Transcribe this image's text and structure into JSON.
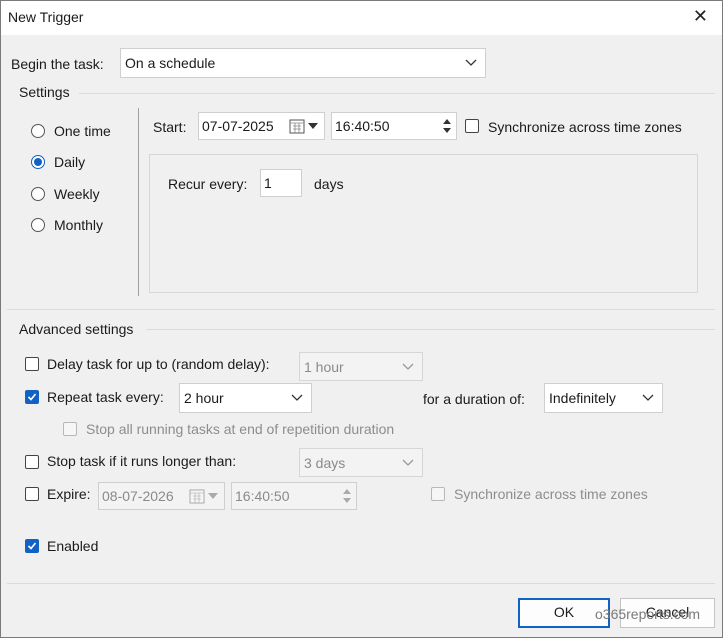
{
  "window": {
    "title": "New Trigger"
  },
  "begin": {
    "label": "Begin the task:",
    "value": "On a schedule"
  },
  "settings": {
    "legend": "Settings",
    "options": [
      "One time",
      "Daily",
      "Weekly",
      "Monthly"
    ],
    "selected": "Daily",
    "start_label": "Start:",
    "start_date": "07-07-2025",
    "start_time": "16:40:50",
    "sync_label": "Synchronize across time zones",
    "sync_checked": false,
    "recur_label": "Recur every:",
    "recur_value": "1",
    "recur_unit": "days"
  },
  "advanced": {
    "legend": "Advanced settings",
    "delay_label": "Delay task for up to (random delay):",
    "delay_checked": false,
    "delay_value": "1 hour",
    "repeat_label": "Repeat task every:",
    "repeat_checked": true,
    "repeat_value": "2 hour",
    "duration_label": "for a duration of:",
    "duration_value": "Indefinitely",
    "stop_all_label": "Stop all running tasks at end of repetition duration",
    "stop_all_checked": false,
    "stop_long_label": "Stop task if it runs longer than:",
    "stop_long_checked": false,
    "stop_long_value": "3 days",
    "expire_label": "Expire:",
    "expire_checked": false,
    "expire_date": "08-07-2026",
    "expire_time": "16:40:50",
    "expire_sync_label": "Synchronize across time zones",
    "enabled_label": "Enabled",
    "enabled_checked": true
  },
  "buttons": {
    "ok": "OK",
    "cancel": "Cancel"
  },
  "watermark": "o365reports.com",
  "colors": {
    "accent": "#1261c4",
    "dialog_bg": "#f0f0f0"
  }
}
